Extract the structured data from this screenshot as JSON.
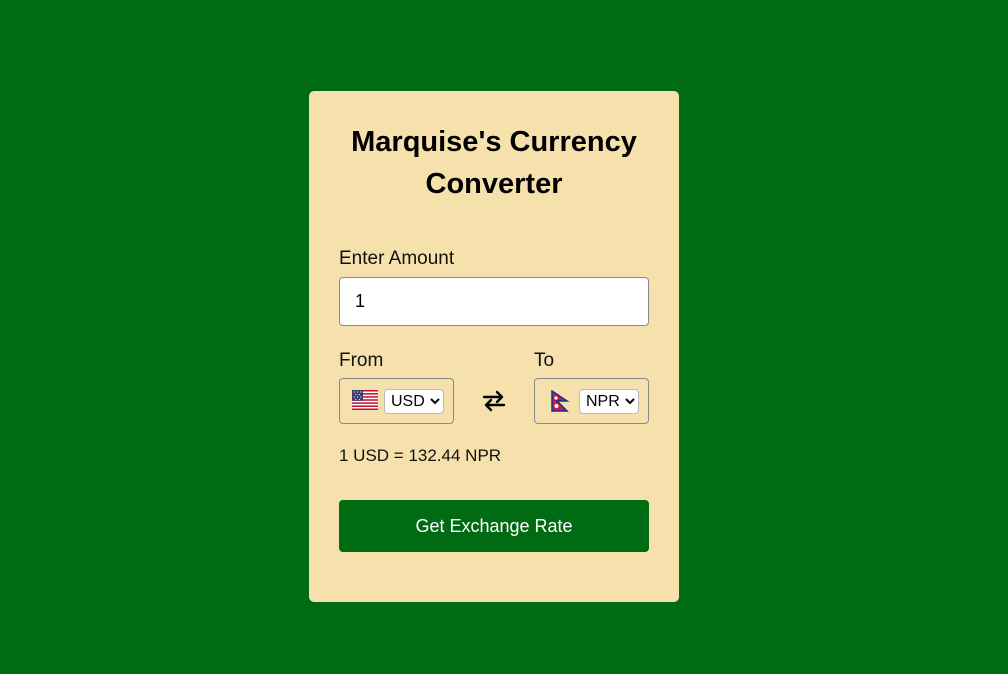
{
  "app": {
    "title": "Marquise's Currency Converter"
  },
  "amount": {
    "label": "Enter Amount",
    "value": "1"
  },
  "from": {
    "label": "From",
    "flag": "us-flag-icon",
    "selected": "USD",
    "options": [
      "USD"
    ]
  },
  "to": {
    "label": "To",
    "flag": "nepal-flag-icon",
    "selected": "NPR",
    "options": [
      "NPR"
    ]
  },
  "rate": {
    "text": "1 USD = 132.44 NPR"
  },
  "button": {
    "label": "Get Exchange Rate"
  },
  "colors": {
    "background": "#006b12",
    "card": "#f6e1ac",
    "button": "#006b12"
  }
}
